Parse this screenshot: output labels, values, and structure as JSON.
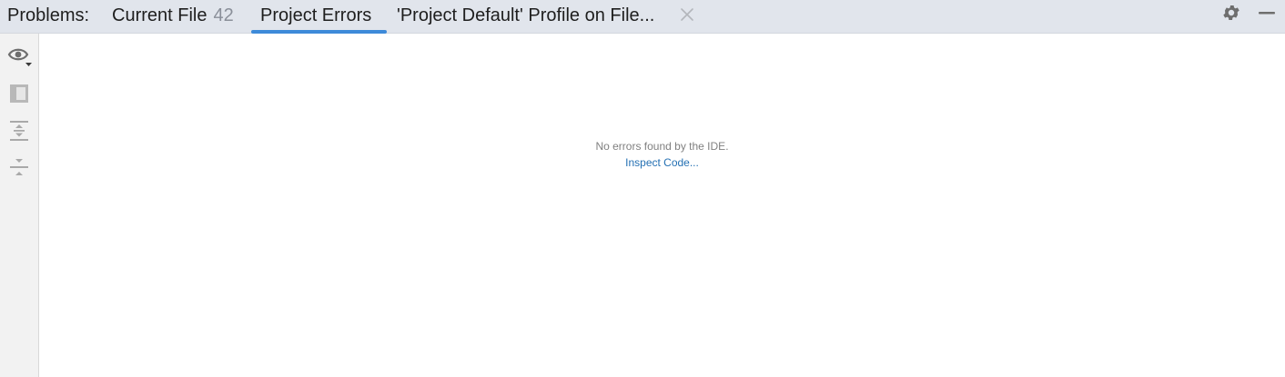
{
  "header": {
    "panel_title": "Problems:",
    "tabs": [
      {
        "label": "Current File",
        "count": "42"
      },
      {
        "label": "Project Errors",
        "selected": true
      },
      {
        "label": "'Project Default' Profile on File..."
      }
    ]
  },
  "icons": {
    "close": "close-icon",
    "settings": "gear-icon",
    "minimize": "minimize-icon",
    "toolbar": [
      "eye-icon",
      "preview-panel-icon",
      "expand-all-icon",
      "collapse-all-icon"
    ]
  },
  "content": {
    "empty_message": "No errors found by the IDE.",
    "inspect_link": "Inspect Code..."
  },
  "colors": {
    "header_bg": "#e1e5ec",
    "accent": "#3d8ad9",
    "link": "#2470b3",
    "toolbar_bg": "#f2f2f2"
  }
}
